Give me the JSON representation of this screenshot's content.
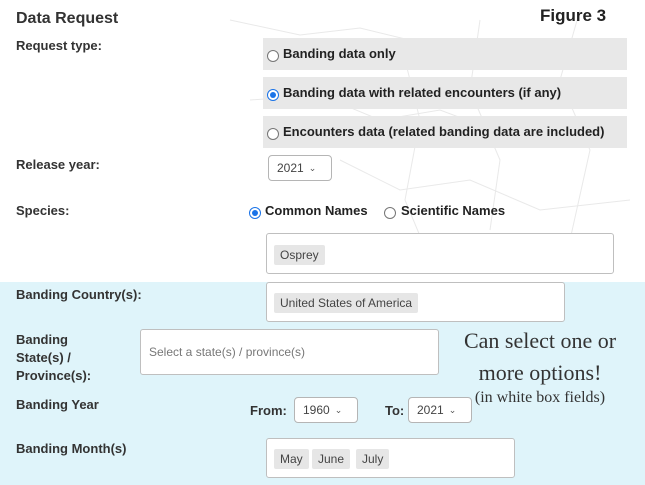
{
  "header": {
    "title": "Data Request",
    "figure_label": "Figure 3"
  },
  "request_type": {
    "label": "Request type:",
    "options": [
      {
        "label": "Banding data only",
        "selected": false
      },
      {
        "label": "Banding data with related encounters (if any)",
        "selected": true
      },
      {
        "label": "Encounters data (related banding data are included)",
        "selected": false
      }
    ]
  },
  "release_year": {
    "label": "Release year:",
    "value": "2021"
  },
  "species": {
    "label": "Species:",
    "name_options": [
      {
        "label": "Common Names",
        "selected": true
      },
      {
        "label": "Scientific Names",
        "selected": false
      }
    ],
    "selected": "Osprey"
  },
  "banding_country": {
    "label": "Banding Country(s):",
    "selected": "United States of America"
  },
  "banding_state": {
    "label_lines": [
      "Banding",
      "State(s) /",
      "Province(s):"
    ],
    "placeholder": "Select a state(s) / province(s)"
  },
  "banding_year": {
    "label": "Banding Year",
    "from_label": "From:",
    "from_value": "1960",
    "to_label": "To:",
    "to_value": "2021"
  },
  "banding_month": {
    "label": "Banding Month(s)",
    "selected": [
      "May",
      "June",
      "July"
    ]
  },
  "annotation": {
    "line1": "Can select one or",
    "line2": "more options!",
    "line3": "(in white box fields)"
  },
  "icons": {
    "dropdown": "chevron-down-icon",
    "radio": "radio-button"
  },
  "colors": {
    "highlight_band": "#dff4fa",
    "option_band": "#e8e8e8",
    "radio_selected": "#1a73e8"
  }
}
